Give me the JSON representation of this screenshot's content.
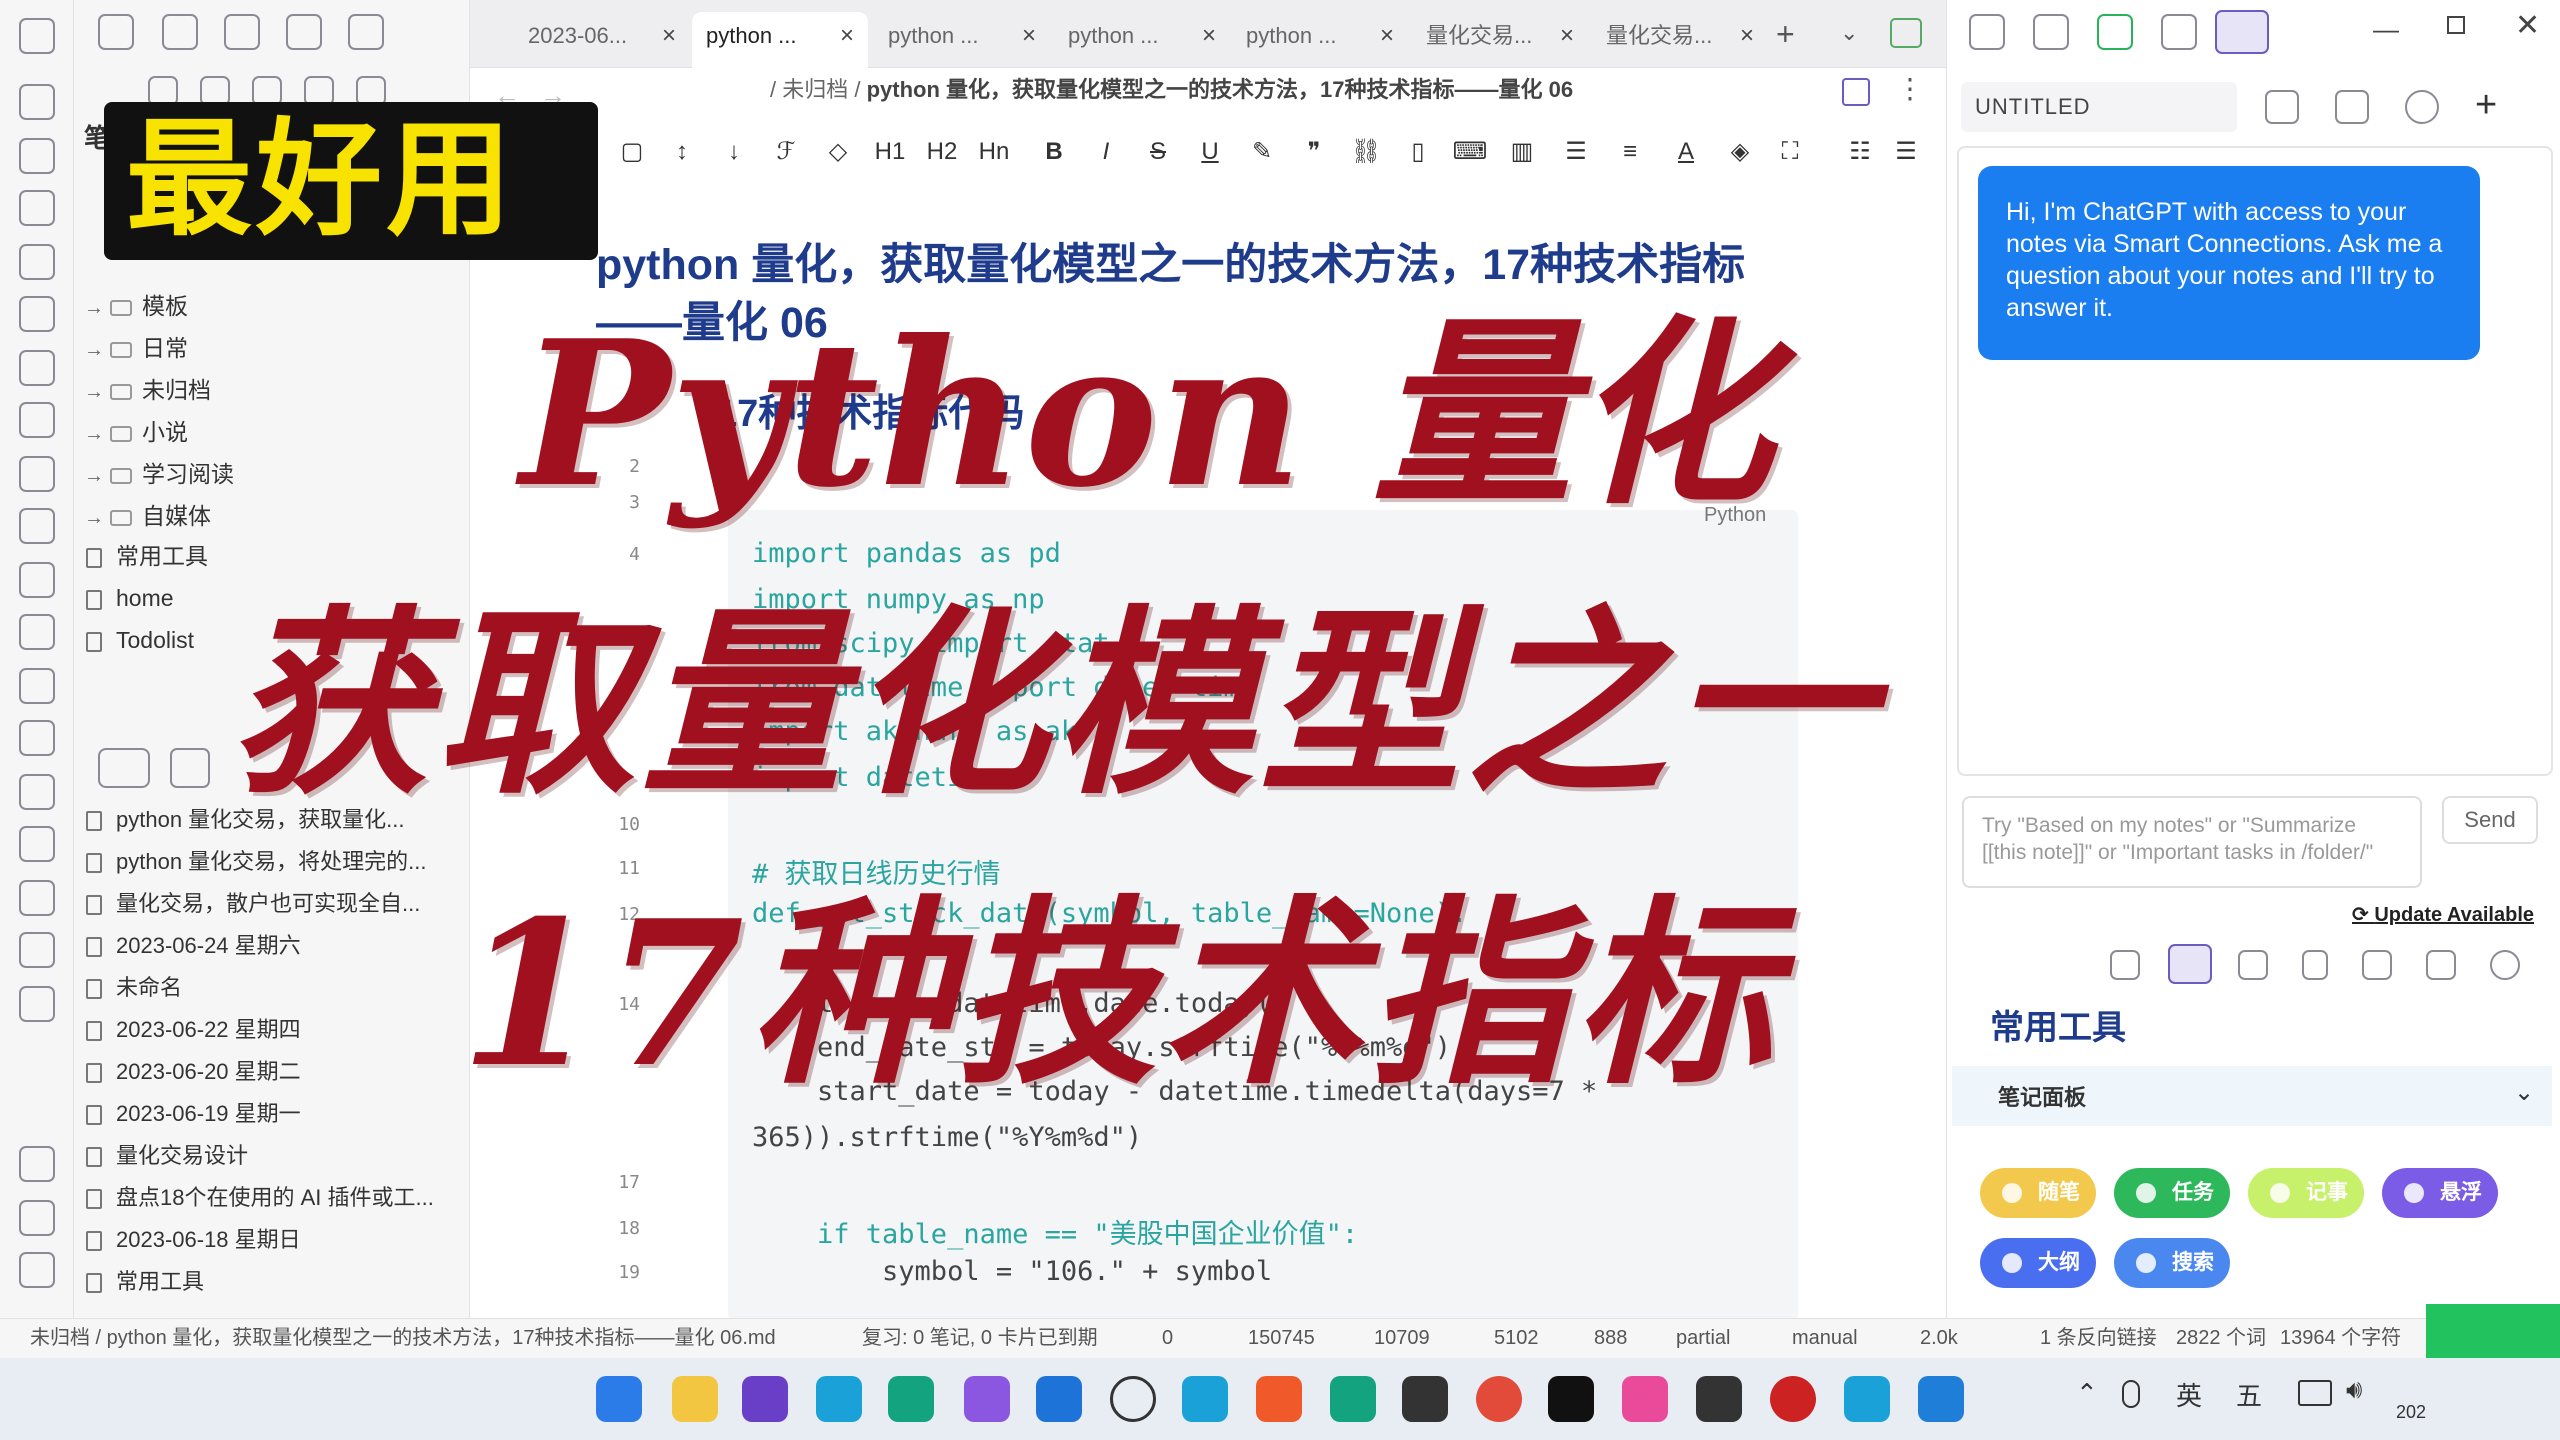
{
  "tabs": [
    {
      "label": "2023-06...",
      "active": false
    },
    {
      "label": "python ...",
      "active": true
    },
    {
      "label": "python ...",
      "active": false
    },
    {
      "label": "python ...",
      "active": false
    },
    {
      "label": "python ...",
      "active": false
    },
    {
      "label": "量化交易...",
      "active": false
    },
    {
      "label": "量化交易...",
      "active": false
    }
  ],
  "filepane": {
    "heading": "笔记",
    "folders": [
      "模板",
      "日常",
      "未归档",
      "小说",
      "学习阅读",
      "自媒体"
    ],
    "files": [
      "常用工具",
      "home",
      "Todolist"
    ]
  },
  "recent": [
    "python 量化交易，获取量化...",
    "python 量化交易，将处理完的...",
    "量化交易，散户也可实现全自...",
    "2023-06-24 星期六",
    "未命名",
    "2023-06-22 星期四",
    "2023-06-20 星期二",
    "2023-06-19 星期一",
    "量化交易设计",
    "盘点18个在使用的 AI 插件或工...",
    "2023-06-18 星期日",
    "常用工具"
  ],
  "editor": {
    "breadcrumb_folder": "/ 未归档 /",
    "breadcrumb_title": "python 量化，获取量化模型之一的技术方法，17种技术指标——量化 06",
    "title": "python 量化，获取量化模型之一的技术方法，17种技术指标——量化 06",
    "subheading": "17种技术指标代码",
    "code_lang": "Python",
    "toolbar": [
      "H1",
      "H2",
      "Hn",
      "B",
      "I",
      "S",
      "U"
    ]
  },
  "code": [
    {
      "n": "2",
      "text": ""
    },
    {
      "n": "3",
      "text": ""
    },
    {
      "n": "4",
      "text": "import pandas as pd"
    },
    {
      "n": "",
      "text": "import numpy as np"
    },
    {
      "n": "",
      "text": "from scipy import stat"
    },
    {
      "n": "",
      "text": "from datetime import date, time"
    },
    {
      "n": "",
      "text": "import akshare as ak"
    },
    {
      "n": "",
      "text": "import datetime"
    },
    {
      "n": "10",
      "text": ""
    },
    {
      "n": "11",
      "text": "# 获取日线历史行情"
    },
    {
      "n": "12",
      "text": "def get_stock_data(symbol, table_name=None):"
    },
    {
      "n": "",
      "text": ""
    },
    {
      "n": "14",
      "text": "    today = datetime.date.today()"
    },
    {
      "n": "",
      "text": "    end_date_str = today.strftime(\"%Y%m%d\")"
    },
    {
      "n": "",
      "text": "    start_date = today - datetime.timedelta(days=7 *"
    },
    {
      "n": "",
      "text": "365)).strftime(\"%Y%m%d\")"
    },
    {
      "n": "17",
      "text": ""
    },
    {
      "n": "18",
      "text": "    if table_name == \"美股中国企业价值\":"
    },
    {
      "n": "19",
      "text": "        symbol = \"106.\" + symbol"
    }
  ],
  "right": {
    "note_title": "UNTITLED",
    "chat_message": "Hi, I'm ChatGPT with access to your notes via Smart Connections. Ask me a question about your notes and I'll try to answer it.",
    "input_placeholder": "Try \"Based on my notes\" or \"Summarize [[this note]]\" or \"Important tasks in /folder/\"",
    "send": "Send",
    "update": "Update Available",
    "tools_heading": "常用工具",
    "panel_title": "笔记面板",
    "pills": [
      {
        "label": "随笔",
        "color": "#f2c94c"
      },
      {
        "label": "任务",
        "color": "#2eb85c"
      },
      {
        "label": "记事",
        "color": "#c7f06b"
      },
      {
        "label": "悬浮",
        "color": "#7b5ce6"
      },
      {
        "label": "大纲",
        "color": "#4a6ef0"
      },
      {
        "label": "搜索",
        "color": "#4a88f0"
      }
    ]
  },
  "statusbar": {
    "path": "未归档 / python 量化，获取量化模型之一的技术方法，17种技术指标——量化 06.md",
    "review": "复习: 0 笔记, 0 卡片已到期",
    "c1": "0",
    "c2": "150745",
    "c3": "10709",
    "c4": "5102",
    "c5": "888",
    "c6": "partial",
    "c7": "manual",
    "c8": "2.0k",
    "backlinks": "1 条反向链接",
    "words": "2822 个词",
    "chars": "13964 个字符"
  },
  "taskbar": {
    "lang": "英",
    "ime": "五",
    "year": "202"
  },
  "overlay": {
    "badge": "最好用",
    "line1": "Python 量化",
    "line2": "获取量化模型之一",
    "line3": "17种技术指标"
  },
  "colors": {
    "accent": "#1a7df0",
    "overlay_red": "#a0101f",
    "badge_yellow": "#f7e200"
  }
}
